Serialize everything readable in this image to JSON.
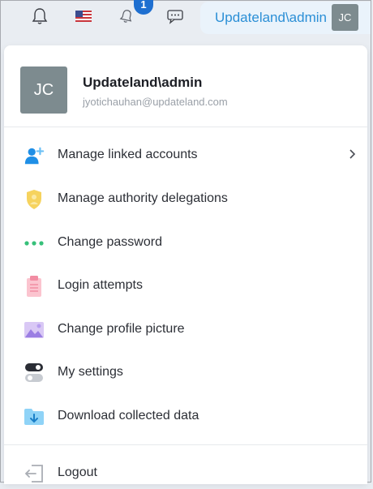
{
  "topbar": {
    "icons": [
      "bell-icon",
      "us-flag-icon",
      "notification-bell-icon",
      "chat-icon"
    ],
    "notification_count": "1",
    "user_name": "Updateland\\admin",
    "avatar_initials": "JC"
  },
  "profile": {
    "avatar_initials": "JC",
    "name": "Updateland\\admin",
    "email": "jyotichauhan@updateland.com"
  },
  "menu": {
    "items": [
      {
        "label": "Manage linked accounts",
        "icon": "linked-accounts-icon",
        "has_submenu": true
      },
      {
        "label": "Manage authority delegations",
        "icon": "shield-icon"
      },
      {
        "label": "Change password",
        "icon": "password-dots-icon"
      },
      {
        "label": "Login attempts",
        "icon": "clipboard-icon"
      },
      {
        "label": "Change profile picture",
        "icon": "picture-icon"
      },
      {
        "label": "My settings",
        "icon": "toggle-settings-icon"
      },
      {
        "label": "Download collected data",
        "icon": "download-folder-icon"
      }
    ],
    "logout_label": "Logout"
  },
  "colors": {
    "accent": "#2b8fd6",
    "badge": "#1e6fd0",
    "avatar_bg": "#7d8b8f"
  }
}
